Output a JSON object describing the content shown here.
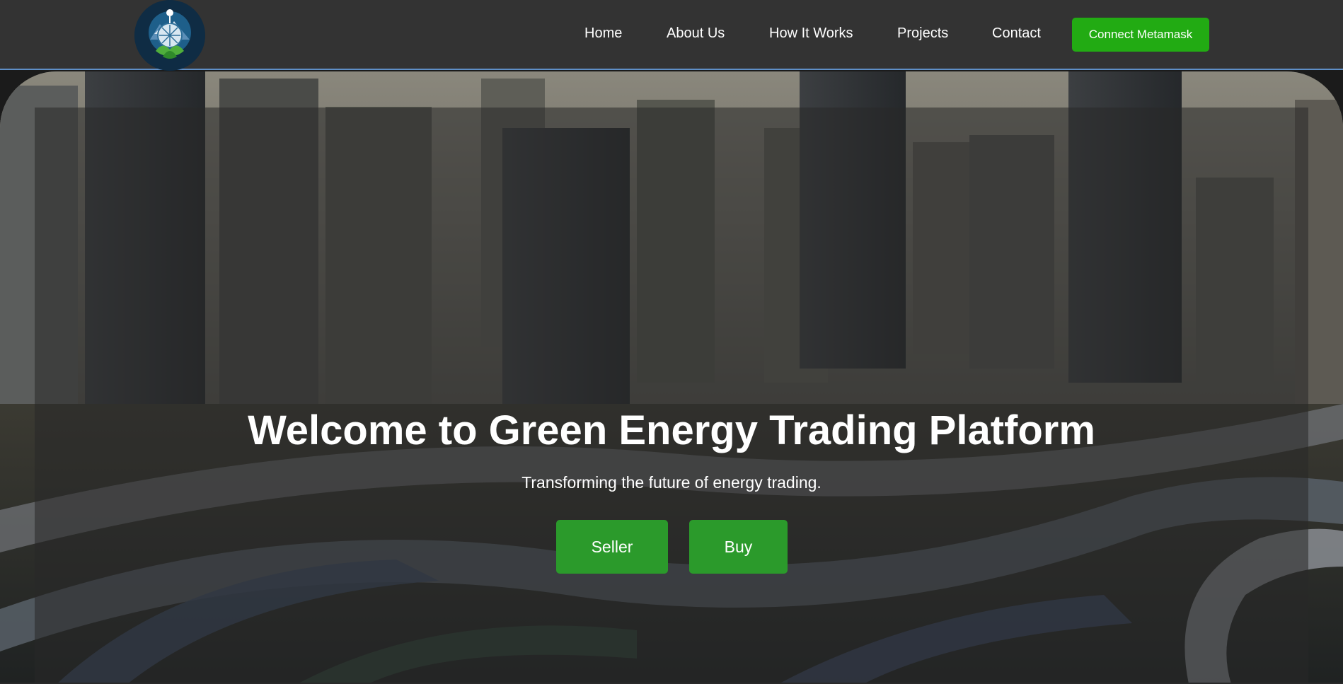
{
  "nav": {
    "logo_alt": "logo-icon",
    "links": [
      "Home",
      "About Us",
      "How It Works",
      "Projects",
      "Contact"
    ],
    "connect_label": "Connect Metamask"
  },
  "hero": {
    "title": "Welcome to Green Energy Trading Platform",
    "subtitle": "Transforming the future of energy trading.",
    "seller_label": "Seller",
    "buy_label": "Buy"
  },
  "colors": {
    "navbar_bg": "#333333",
    "connect_button": "#22ab13",
    "action_button": "#2b9a2b",
    "text": "#ffffff"
  }
}
